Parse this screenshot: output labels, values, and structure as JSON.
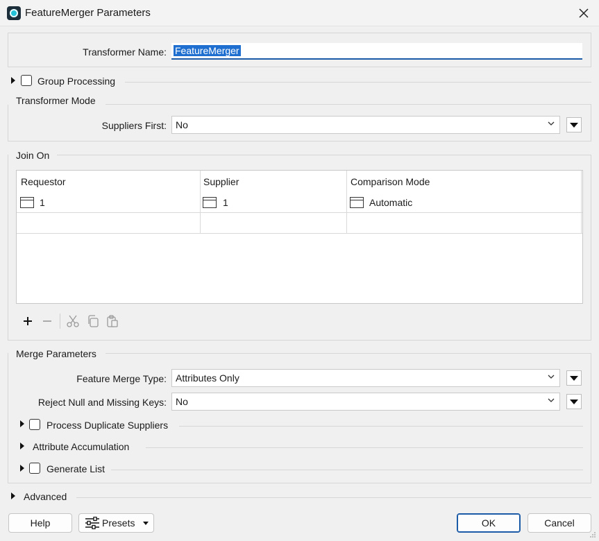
{
  "window": {
    "title": "FeatureMerger Parameters"
  },
  "transformer": {
    "name_label": "Transformer Name:",
    "name_value": "FeatureMerger"
  },
  "group_processing": {
    "label": "Group Processing"
  },
  "transformer_mode": {
    "heading": "Transformer Mode",
    "suppliers_first_label": "Suppliers First:",
    "suppliers_first_value": "No"
  },
  "join_on": {
    "heading": "Join On",
    "columns": [
      "Requestor",
      "Supplier",
      "Comparison Mode"
    ],
    "rows": [
      [
        "1",
        "1",
        "Automatic"
      ]
    ]
  },
  "merge_parameters": {
    "heading": "Merge Parameters",
    "feature_merge_type_label": "Feature Merge Type:",
    "feature_merge_type_value": "Attributes Only",
    "reject_null_label": "Reject Null and Missing Keys:",
    "reject_null_value": "No",
    "process_duplicate_suppliers_label": "Process Duplicate Suppliers",
    "attribute_accumulation_label": "Attribute Accumulation",
    "generate_list_label": "Generate List"
  },
  "advanced": {
    "label": "Advanced"
  },
  "buttons": {
    "help": "Help",
    "presets": "Presets",
    "ok": "OK",
    "cancel": "Cancel"
  },
  "colors": {
    "accent": "#1b5aa6",
    "selection": "#1f6fd0",
    "icon_teal": "#22c3d8"
  }
}
